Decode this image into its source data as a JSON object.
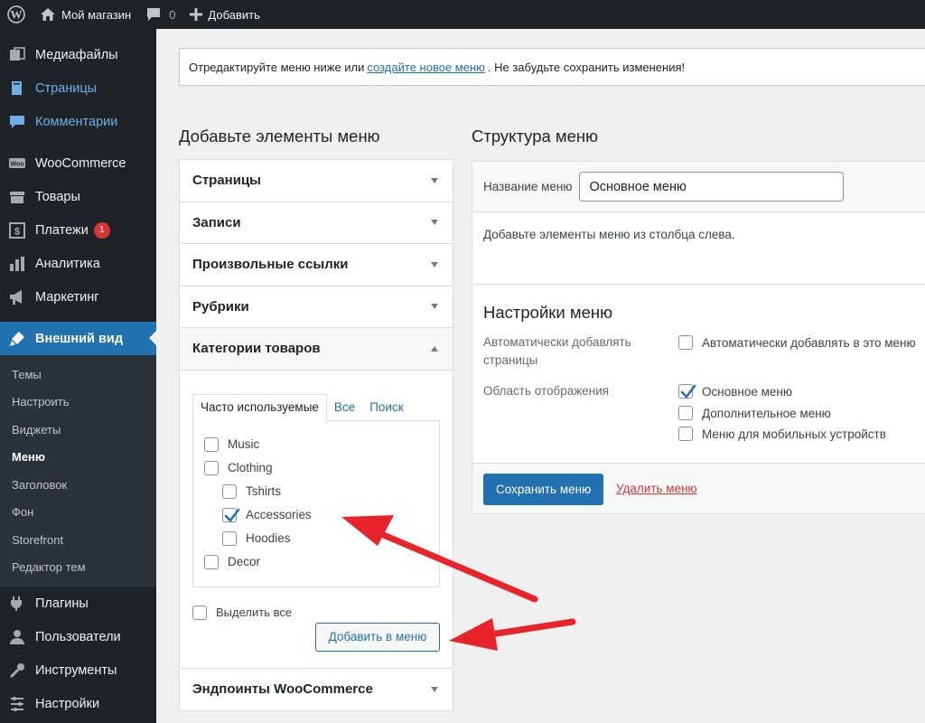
{
  "adminbar": {
    "site_name": "Мой магазин",
    "comments_count": "0",
    "add_new": "Добавить"
  },
  "sidebar": {
    "top_items": [
      {
        "label": "Медиафайлы",
        "icon": "media-icon"
      },
      {
        "label": "Страницы",
        "icon": "pages-icon"
      },
      {
        "label": "Комментарии",
        "icon": "comments-icon"
      }
    ],
    "woo_items": [
      {
        "label": "WooCommerce",
        "icon": "woocommerce-icon"
      },
      {
        "label": "Товары",
        "icon": "products-icon"
      },
      {
        "label": "Платежи",
        "icon": "payments-icon",
        "badge": "1"
      },
      {
        "label": "Аналитика",
        "icon": "analytics-icon"
      },
      {
        "label": "Маркетинг",
        "icon": "marketing-icon"
      }
    ],
    "current": {
      "label": "Внешний вид",
      "icon": "appearance-icon"
    },
    "submenu": [
      "Темы",
      "Настроить",
      "Виджеты",
      "Меню",
      "Заголовок",
      "Фон",
      "Storefront",
      "Редактор тем"
    ],
    "submenu_current": "Меню",
    "bottom_items": [
      {
        "label": "Плагины",
        "icon": "plugins-icon"
      },
      {
        "label": "Пользователи",
        "icon": "users-icon"
      },
      {
        "label": "Инструменты",
        "icon": "tools-icon"
      },
      {
        "label": "Настройки",
        "icon": "settings-icon"
      }
    ]
  },
  "notice": {
    "text_before": "Отредактируйте меню ниже или",
    "link": "создайте новое меню",
    "text_after": ". Не забудьте сохранить изменения!"
  },
  "left": {
    "title": "Добавьте элементы меню",
    "sections": [
      "Страницы",
      "Записи",
      "Произвольные ссылки",
      "Рубрики"
    ],
    "open_section": "Категории товаров",
    "tabs": [
      "Часто используемые",
      "Все",
      "Поиск"
    ],
    "categories": [
      {
        "label": "Music",
        "checked": false,
        "level": 0
      },
      {
        "label": "Clothing",
        "checked": false,
        "level": 0
      },
      {
        "label": "Tshirts",
        "checked": false,
        "level": 1
      },
      {
        "label": "Accessories",
        "checked": true,
        "level": 1
      },
      {
        "label": "Hoodies",
        "checked": false,
        "level": 1
      },
      {
        "label": "Decor",
        "checked": false,
        "level": 0
      }
    ],
    "select_all": "Выделить все",
    "add_button": "Добавить в меню",
    "last_section": "Эндпоинты WooCommerce"
  },
  "right": {
    "title": "Структура меню",
    "name_label": "Название меню",
    "name_value": "Основное меню",
    "empty_message": "Добавьте элементы меню из столбца слева.",
    "settings_title": "Настройки меню",
    "auto_add_label": "Автоматически добавлять страницы",
    "auto_add_option": "Автоматически добавлять в это меню",
    "location_label": "Область отображения",
    "locations": [
      {
        "label": "Основное меню",
        "checked": true
      },
      {
        "label": "Дополнительное меню",
        "checked": false
      },
      {
        "label": "Меню для мобильных устройств",
        "checked": false
      }
    ],
    "save_button": "Сохранить меню",
    "delete_link": "Удалить меню"
  },
  "colors": {
    "accent": "#2271b1",
    "sidebar_bg": "#1d2327",
    "danger": "#d63638",
    "annotation": "#e8232a"
  }
}
